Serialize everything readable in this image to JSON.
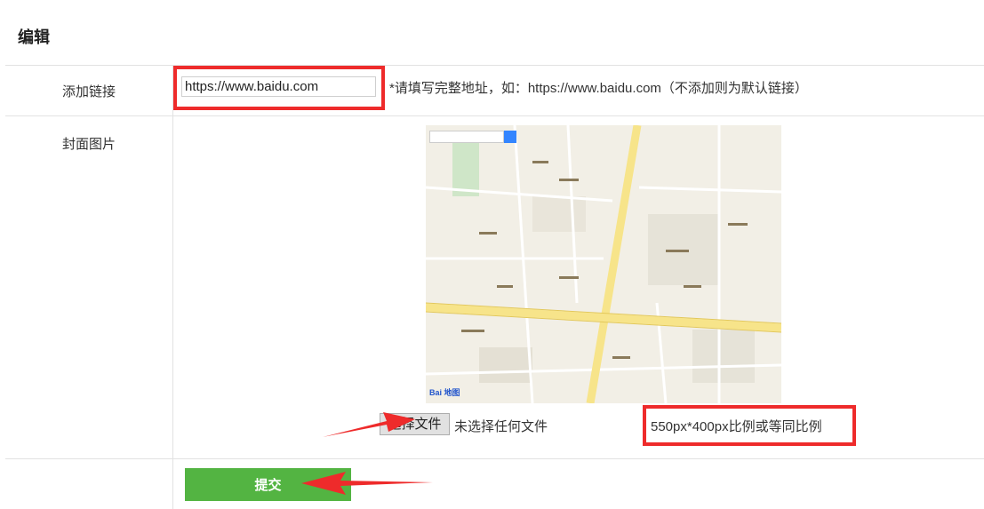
{
  "page": {
    "title": "编辑"
  },
  "link_row": {
    "label": "添加链接",
    "input_value": "https://www.baidu.com",
    "hint": "*请填写完整地址，如：https://www.baidu.com（不添加则为默认链接）"
  },
  "cover_row": {
    "label": "封面图片",
    "choose_file_label": "选择文件",
    "no_file_text": "未选择任何文件",
    "size_hint": "550px*400px比例或等同比例",
    "map_logo": "Bai 地图"
  },
  "submit": {
    "label": "提交"
  },
  "colors": {
    "annotation_red": "#ee2b2b",
    "submit_green": "#53b442",
    "map_road_yellow": "#f7e48a",
    "map_land": "#f2efe6"
  }
}
